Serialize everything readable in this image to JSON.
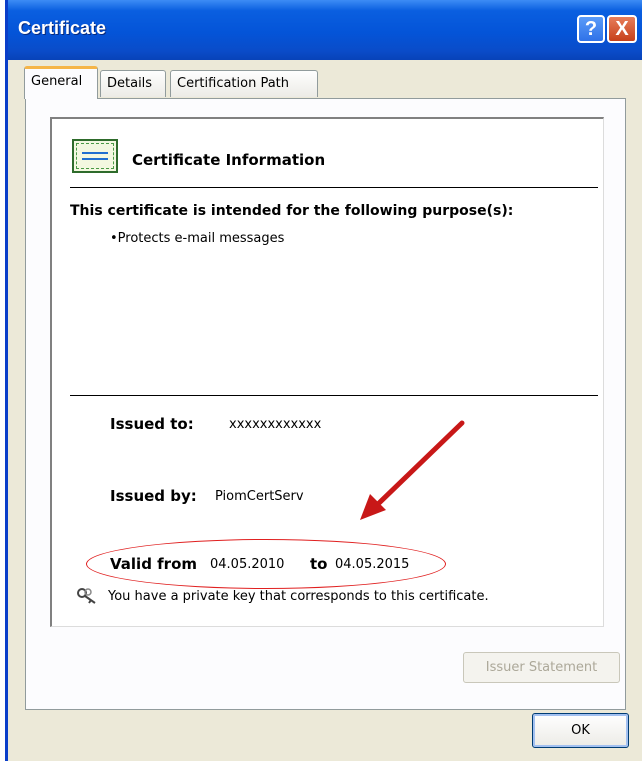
{
  "window": {
    "title": "Certificate",
    "help_label": "?",
    "close_label": "X"
  },
  "tabs": [
    {
      "label": "General",
      "active": true
    },
    {
      "label": "Details",
      "active": false
    },
    {
      "label": "Certification Path",
      "active": false
    }
  ],
  "certificate": {
    "heading": "Certificate Information",
    "purpose_heading": "This certificate is intended for the following purpose(s):",
    "purposes": [
      "•Protects e-mail messages"
    ],
    "issued_to_label": "Issued to:",
    "issued_to_value": "xxxxxxxxxxxx",
    "issued_by_label": "Issued by:",
    "issued_by_value": "PiomCertServ",
    "valid_from_label": "Valid from",
    "valid_from_value": "04.05.2010",
    "valid_to_label": "to",
    "valid_to_value": "04.05.2015",
    "private_key_note": "You have a private key that corresponds to this certificate."
  },
  "buttons": {
    "issuer_statement": "Issuer Statement",
    "ok": "OK"
  },
  "icons": {
    "certificate": "certificate-icon",
    "key": "key-icon",
    "help": "help-icon",
    "close": "close-icon"
  },
  "colors": {
    "titlebar": "#0454d8",
    "annotation": "#d01818",
    "tab_highlight": "#f5b549"
  }
}
